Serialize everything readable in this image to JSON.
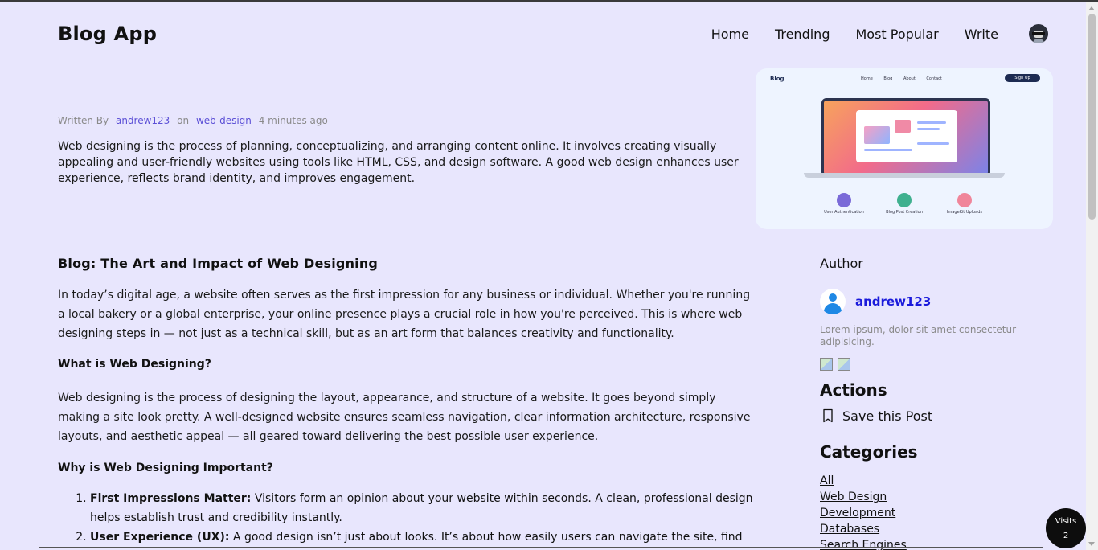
{
  "header": {
    "logo": "Blog App",
    "nav": [
      "Home",
      "Trending",
      "Most Popular",
      "Write"
    ]
  },
  "post": {
    "meta": {
      "written_by": "Written By",
      "author": "andrew123",
      "on": "on",
      "category": "web-design",
      "time": "4 minutes ago"
    },
    "summary": "Web designing is the process of planning, conceptualizing, and arranging content online. It involves creating visually appealing and user-friendly websites using tools like HTML, CSS, and design software. A good web design enhances user experience, reflects brand identity, and improves engagement.",
    "hero": {
      "logo": "Blog",
      "nav": [
        "Home",
        "Blog",
        "About",
        "Contact"
      ],
      "button": "Sign Up",
      "features": [
        "User Authentication",
        "Blog Post Creation",
        "ImageKit Uploads"
      ]
    }
  },
  "article": {
    "title": "Blog: The Art and Impact of Web Designing",
    "p1": "In today’s digital age, a website often serves as the first impression for any business or individual. Whether you're running a local bakery or a global enterprise, your online presence plays a crucial role in how you're perceived. This is where web designing steps in — not just as a technical skill, but as an art form that balances creativity and functionality.",
    "h2_1": "What is Web Designing?",
    "p2": "Web designing is the process of designing the layout, appearance, and structure of a website. It goes beyond simply making a site look pretty. A well-designed website ensures seamless navigation, clear information architecture, responsive layouts, and aesthetic appeal — all geared toward delivering the best possible user experience.",
    "h2_2": "Why is Web Designing Important?",
    "list": [
      {
        "bold": "First Impressions Matter:",
        "text": " Visitors form an opinion about your website within seconds. A clean, professional design helps establish trust and credibility instantly."
      },
      {
        "bold": "User Experience (UX):",
        "text": " A good design isn’t just about looks. It’s about how easily users can navigate the site, find what"
      }
    ]
  },
  "sidebar": {
    "author_heading": "Author",
    "author_name": "andrew123",
    "author_bio": "Lorem ipsum, dolor sit amet consectetur adipisicing.",
    "actions_heading": "Actions",
    "save_label": "Save this Post",
    "categories_heading": "Categories",
    "categories": [
      "All",
      "Web Design",
      "Development",
      "Databases",
      "Search Engines"
    ]
  },
  "visits": {
    "label": "Visits",
    "count": "2"
  }
}
